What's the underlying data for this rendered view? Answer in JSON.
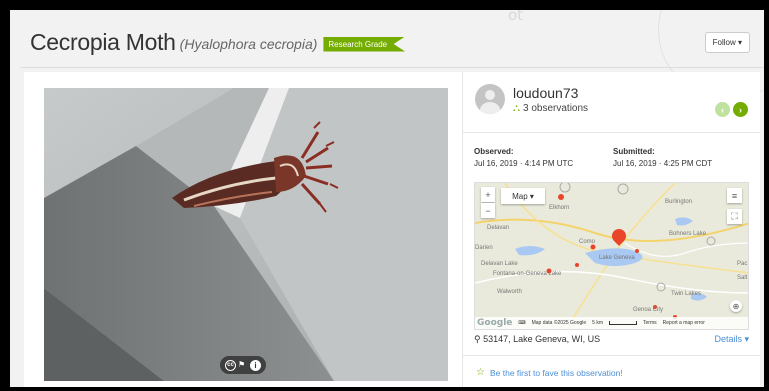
{
  "header": {
    "top_fragment": "ot",
    "title": "Cecropia Moth",
    "scientific_name": "(Hyalophora cecropia)",
    "grade_badge": "Research Grade",
    "follow_label": "Follow ▾"
  },
  "observer": {
    "username": "loudoun73",
    "observations": "3 observations"
  },
  "dates": {
    "observed_label": "Observed:",
    "observed_value": "Jul 16, 2019 · 4:14 PM UTC",
    "submitted_label": "Submitted:",
    "submitted_value": "Jul 16, 2019 · 4:25 PM CDT"
  },
  "map": {
    "type_label": "Map ▾",
    "places": {
      "elkhorn": "Elkhorn",
      "burlington": "Burlington",
      "delavan": "Delavan",
      "bohners_lake": "Bohners Lake",
      "darien": "Darien",
      "delavan_lake": "Delavan Lake",
      "como": "Como",
      "lake_geneva": "Lake Geneva",
      "fontana": "Fontana-on-Geneva Lake",
      "walworth": "Walworth",
      "twin_lakes": "Twin Lakes",
      "genoa_city": "Genoa City",
      "pac": "Pac",
      "salt": "Salt"
    },
    "attribution": {
      "google": "Google",
      "data": "Map data ©2025 Google",
      "scale": "5 km",
      "terms": "Terms",
      "report": "Report a map error"
    }
  },
  "location": {
    "place": "53147, Lake Geneva, WI, US",
    "details_label": "Details ▾"
  },
  "fave_text": "Be the first to fave this observation!",
  "colors": {
    "accent_green": "#74ac00",
    "link_blue": "#4b8fd6",
    "pin_red": "#e8452a"
  }
}
